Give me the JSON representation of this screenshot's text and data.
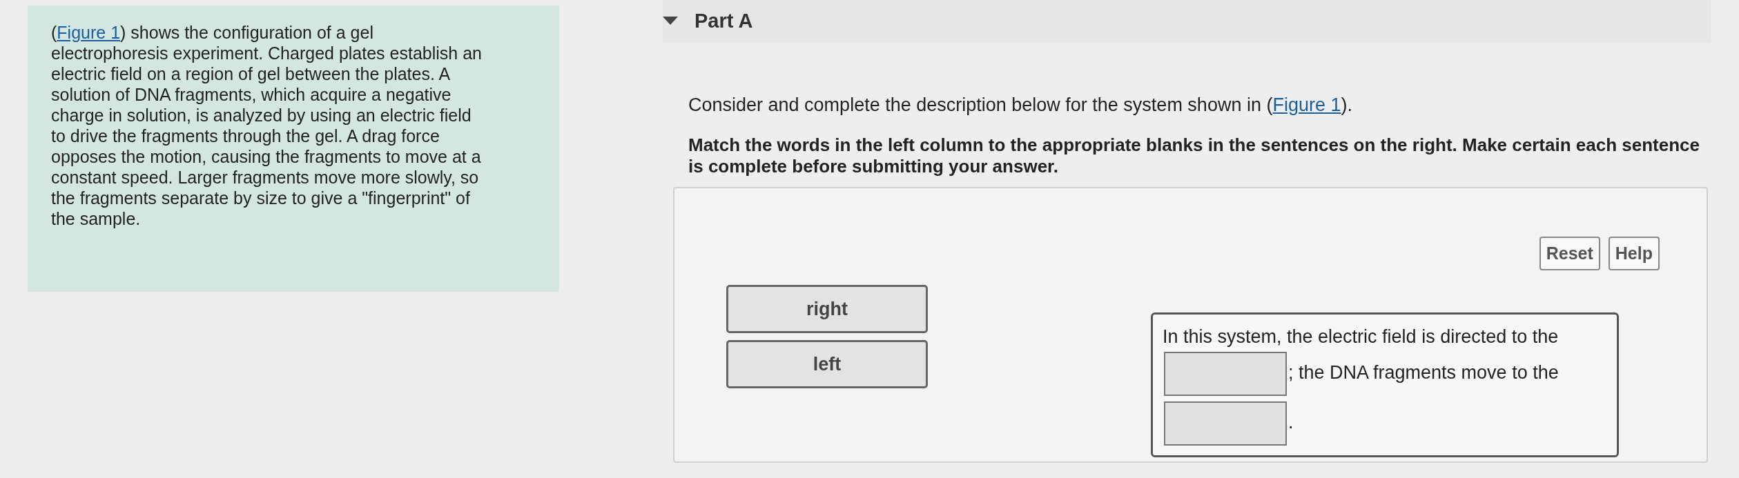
{
  "intro": {
    "before": "(",
    "link": "Figure 1",
    "after": ") shows the configuration of a gel electrophoresis experiment. Charged plates establish an electric field on a region of gel between the plates. A solution of DNA fragments, which acquire a negative charge in solution, is analyzed by using an electric field to drive the fragments through the gel. A drag force opposes the motion, causing the fragments to move at a constant speed. Larger fragments move more slowly, so the fragments separate by size to give a \"fingerprint\" of the sample."
  },
  "part": {
    "title": "Part A",
    "expanded": true
  },
  "prompt": {
    "before": "Consider and complete the description below for the system shown in (",
    "link": "Figure 1",
    "after": ")."
  },
  "instructions": "Match the words in the left column to the appropriate blanks in the sentences on the right. Make certain each sentence is complete before submitting your answer.",
  "buttons": [
    "Reset",
    "Help"
  ],
  "words": [
    "right",
    "left"
  ],
  "sentence": [
    {
      "kind": "text",
      "text": "In this system, the electric field is directed to the"
    },
    {
      "kind": "blank"
    },
    {
      "kind": "text",
      "text": "; the DNA fragments move to the"
    },
    {
      "kind": "blank"
    },
    {
      "kind": "text",
      "text": "."
    }
  ]
}
